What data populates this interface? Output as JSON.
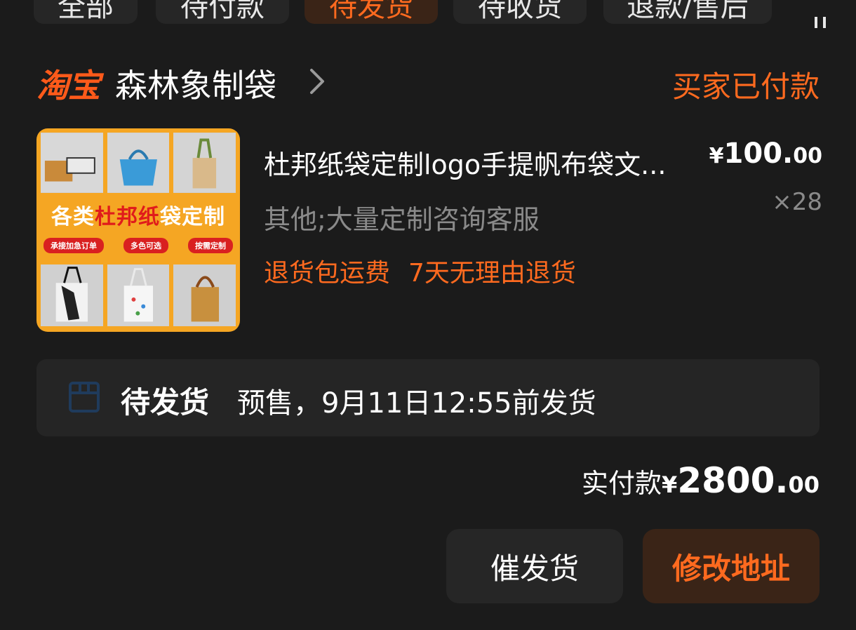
{
  "tabs": [
    {
      "label": "全部",
      "active": false
    },
    {
      "label": "待付款",
      "active": false
    },
    {
      "label": "待发货",
      "active": true
    },
    {
      "label": "待收货",
      "active": false
    },
    {
      "label": "退款/售后",
      "active": false
    }
  ],
  "store": {
    "platform": "淘宝",
    "name": "森林象制袋",
    "status": "买家已付款"
  },
  "product": {
    "title": "杜邦纸袋定制logo手提帆布袋文...",
    "sku": "其他;大量定制咨询客服",
    "tags": [
      "退货包运费",
      "7天无理由退货"
    ],
    "price_currency": "¥",
    "price_int": "100.",
    "price_dec": "00",
    "quantity": "×28",
    "thumb": {
      "banner_pre": "各类",
      "banner_hl": "杜邦纸",
      "banner_post": "袋定制",
      "pills": [
        "承接加急订单",
        "多色可选",
        "按需定制"
      ]
    }
  },
  "shipping": {
    "status": "待发货",
    "note": "预售，9月11日12:55前发货"
  },
  "total": {
    "label": "实付款",
    "currency": "¥",
    "int": "2800.",
    "dec": "00"
  },
  "actions": {
    "remind_label": "催发货",
    "address_label": "修改地址"
  },
  "colors": {
    "accent": "#ff6a1f",
    "background": "#1b1b1b",
    "card": "#252525"
  }
}
